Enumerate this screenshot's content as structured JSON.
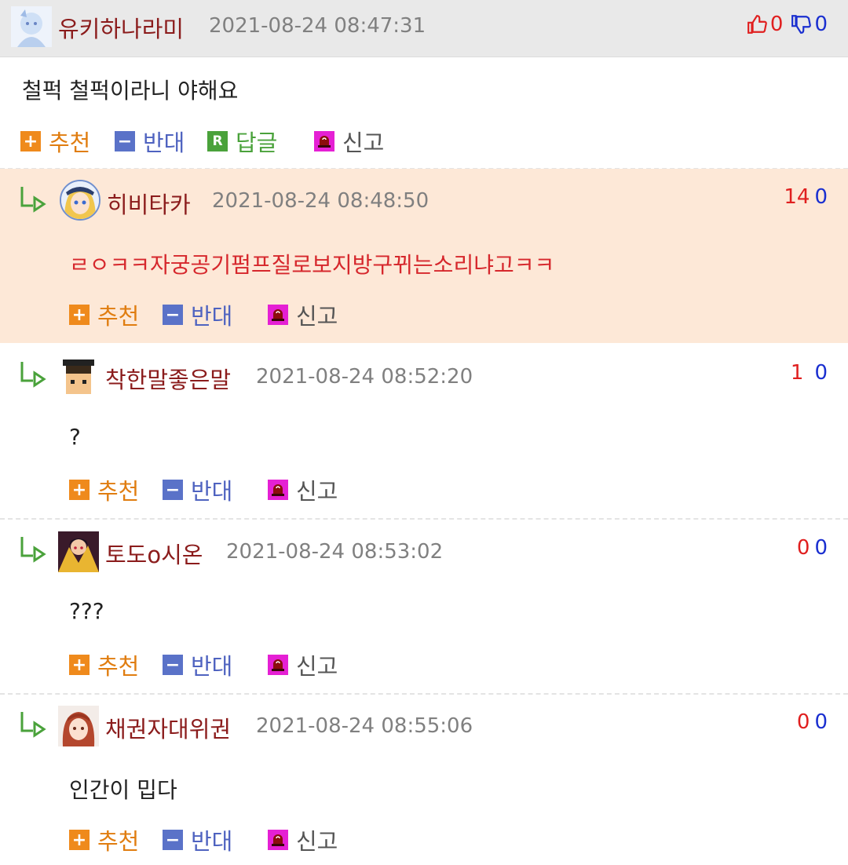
{
  "main_comment": {
    "nickname": "유키하나라미",
    "datetime": "2021-08-24 08:47:31",
    "upvotes": "0",
    "downvotes": "0",
    "text": "철퍽 철퍽이라니 야해요",
    "actions": {
      "recommend": "추천",
      "oppose": "반대",
      "reply": "답글",
      "report": "신고"
    }
  },
  "replies": [
    {
      "nickname": "히비타카",
      "datetime": "2021-08-24 08:48:50",
      "upvotes": "14",
      "downvotes": "0",
      "text": "ㄹㅇㅋㅋ자궁공기펌프질로보지방구뀌는소리냐고ㅋㅋ",
      "highlight": true,
      "actions": {
        "recommend": "추천",
        "oppose": "반대",
        "report": "신고"
      }
    },
    {
      "nickname": "착한말좋은말",
      "datetime": "2021-08-24 08:52:20",
      "upvotes": "1",
      "downvotes": "0",
      "text": "?",
      "actions": {
        "recommend": "추천",
        "oppose": "반대",
        "report": "신고"
      }
    },
    {
      "nickname": "토도o시온",
      "datetime": "2021-08-24 08:53:02",
      "upvotes": "0",
      "downvotes": "0",
      "text": "???",
      "actions": {
        "recommend": "추천",
        "oppose": "반대",
        "report": "신고"
      }
    },
    {
      "nickname": "채권자대위권",
      "datetime": "2021-08-24 08:55:06",
      "upvotes": "0",
      "downvotes": "0",
      "text": "인간이 밉다",
      "actions": {
        "recommend": "추천",
        "oppose": "반대",
        "report": "신고"
      }
    }
  ],
  "colors": {
    "nickname": "#8b1c1c",
    "upvote": "#e01f1f",
    "downvote": "#1a2fd0",
    "highlight_bg": "#fde8d7",
    "recommend": "#ef8a1c",
    "oppose": "#5a72c8",
    "reply": "#4aa23b",
    "report": "#e520d4"
  },
  "icons": {
    "upvote": "thumbs-up-icon",
    "downvote": "thumbs-down-icon",
    "recommend": "plus-icon",
    "oppose": "minus-icon",
    "reply": "r-icon",
    "report": "siren-icon",
    "reply_marker": "reply-arrow-icon"
  }
}
